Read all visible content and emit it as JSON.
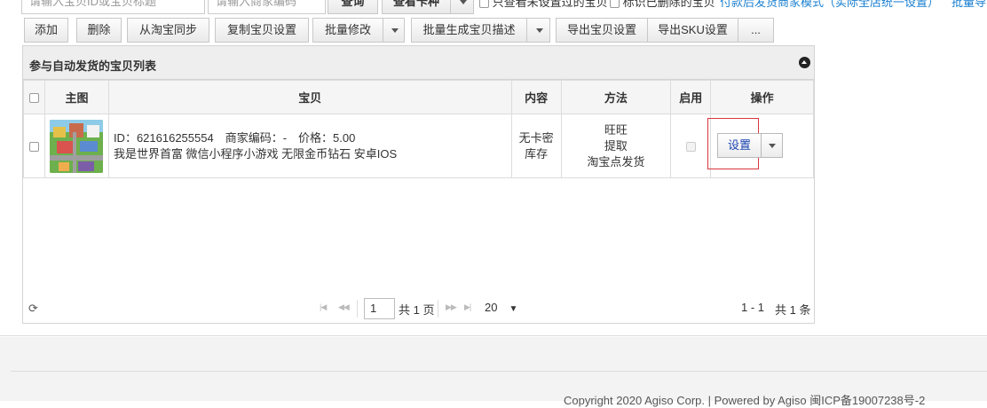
{
  "filters": {
    "search_placeholder": "请输入宝贝ID或宝贝标题",
    "merchant_code_placeholder": "请输入商家编码",
    "query_button": "查询",
    "view_cards_button": "查看卡种",
    "only_unset_label": "只查看未设置过的宝贝",
    "mark_deleted_label": "标识已删除的宝贝",
    "paid_ship_link": "付款后发货商家模式（实际全店统一设置）",
    "batch_link": "批量导"
  },
  "toolbar": {
    "add": "添加",
    "delete": "删除",
    "sync_taobao": "从淘宝同步",
    "copy_settings": "复制宝贝设置",
    "batch_modify": "批量修改",
    "batch_generate": "批量生成宝贝描述",
    "export_settings": "导出宝贝设置",
    "export_sku": "导出SKU设置",
    "more": "..."
  },
  "panel": {
    "title": "参与自动发货的宝贝列表"
  },
  "table": {
    "headers": [
      "主图",
      "宝贝",
      "内容",
      "方法",
      "启用",
      "操作"
    ],
    "rows": [
      {
        "id_line": "ID：621616255554　商家编码：-　价格：5.00",
        "title": "我是世界首富 微信小程序小游戏 无限金币钻石 安卓IOS",
        "content": [
          "无卡密",
          "库存"
        ],
        "method": [
          "旺旺",
          "提取",
          "淘宝点发货"
        ],
        "enabled": false,
        "action_label": "设置"
      }
    ]
  },
  "pager": {
    "page": "1",
    "total_pages": "共 1 页",
    "page_size": "20",
    "range": "1 - 1",
    "total": "共 1 条"
  },
  "footer": {
    "copyright": "Copyright 2020 Agiso Corp. | Powered by Agiso 闽ICP备19007238号-2"
  }
}
